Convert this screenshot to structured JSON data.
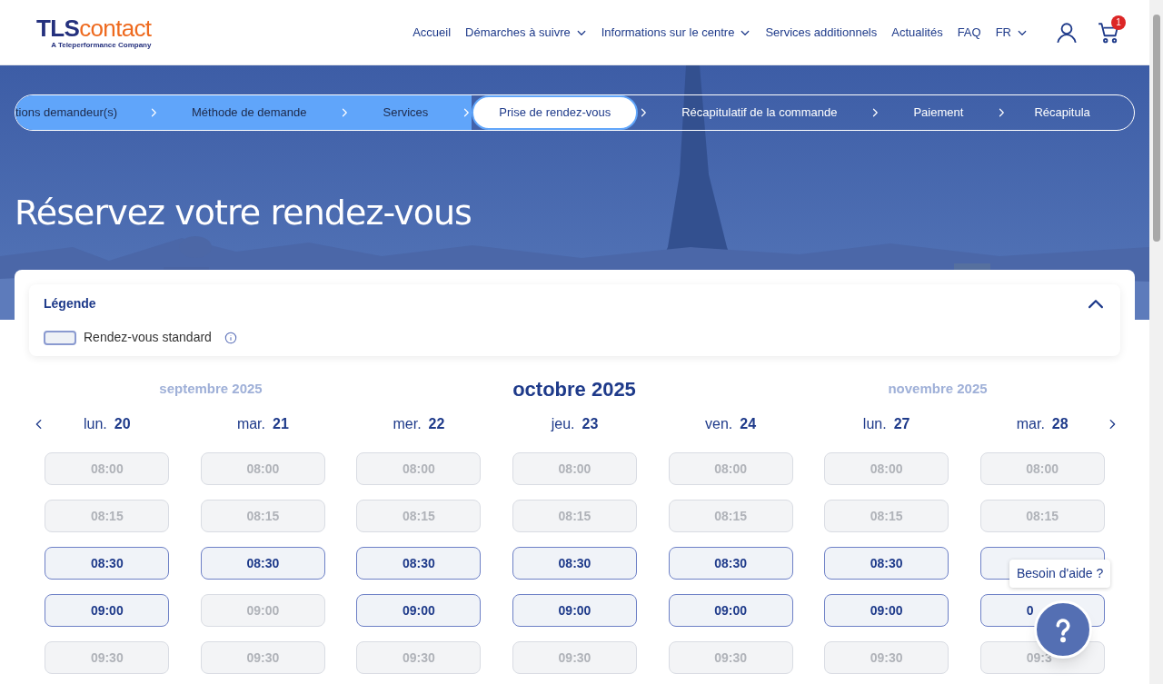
{
  "header": {
    "logo": {
      "primary": "TLS",
      "secondary": "contact",
      "tagline": "A Teleperformance Company"
    },
    "nav": [
      {
        "label": "Accueil",
        "dropdown": false
      },
      {
        "label": "Démarches à suivre",
        "dropdown": true
      },
      {
        "label": "Informations sur le centre",
        "dropdown": true
      },
      {
        "label": "Services additionnels",
        "dropdown": false
      },
      {
        "label": "Actualités",
        "dropdown": false
      },
      {
        "label": "FAQ",
        "dropdown": false
      },
      {
        "label": "FR",
        "dropdown": true
      }
    ],
    "cart_count": "1"
  },
  "steps": [
    {
      "label": "tions demandeur(s)",
      "done": true,
      "selected": false
    },
    {
      "label": "Méthode de demande",
      "done": true,
      "selected": false
    },
    {
      "label": "Services",
      "done": true,
      "selected": false
    },
    {
      "label": "Prise de rendez-vous",
      "done": false,
      "selected": true
    },
    {
      "label": "Récapitulatif de la commande",
      "done": false,
      "selected": false
    },
    {
      "label": "Paiement",
      "done": false,
      "selected": false
    },
    {
      "label": "Récapitula",
      "done": false,
      "selected": false
    }
  ],
  "title": "Réservez votre rendez-vous",
  "legend": {
    "title": "Légende",
    "expanded": true,
    "items": [
      {
        "label": "Rendez-vous standard"
      }
    ]
  },
  "months": [
    {
      "label": "septembre 2025",
      "selected": false
    },
    {
      "label": "octobre 2025",
      "selected": true
    },
    {
      "label": "novembre 2025",
      "selected": false
    }
  ],
  "days": [
    {
      "weekday": "lun.",
      "date": "20",
      "slots": [
        {
          "time": "08:00",
          "available": false
        },
        {
          "time": "08:15",
          "available": false
        },
        {
          "time": "08:30",
          "available": true
        },
        {
          "time": "09:00",
          "available": true
        },
        {
          "time": "09:30",
          "available": false
        }
      ]
    },
    {
      "weekday": "mar.",
      "date": "21",
      "slots": [
        {
          "time": "08:00",
          "available": false
        },
        {
          "time": "08:15",
          "available": false
        },
        {
          "time": "08:30",
          "available": true
        },
        {
          "time": "09:00",
          "available": false
        },
        {
          "time": "09:30",
          "available": false
        }
      ]
    },
    {
      "weekday": "mer.",
      "date": "22",
      "slots": [
        {
          "time": "08:00",
          "available": false
        },
        {
          "time": "08:15",
          "available": false
        },
        {
          "time": "08:30",
          "available": true
        },
        {
          "time": "09:00",
          "available": true
        },
        {
          "time": "09:30",
          "available": false
        }
      ]
    },
    {
      "weekday": "jeu.",
      "date": "23",
      "slots": [
        {
          "time": "08:00",
          "available": false
        },
        {
          "time": "08:15",
          "available": false
        },
        {
          "time": "08:30",
          "available": true
        },
        {
          "time": "09:00",
          "available": true
        },
        {
          "time": "09:30",
          "available": false
        }
      ]
    },
    {
      "weekday": "ven.",
      "date": "24",
      "slots": [
        {
          "time": "08:00",
          "available": false
        },
        {
          "time": "08:15",
          "available": false
        },
        {
          "time": "08:30",
          "available": true
        },
        {
          "time": "09:00",
          "available": true
        },
        {
          "time": "09:30",
          "available": false
        }
      ]
    },
    {
      "weekday": "lun.",
      "date": "27",
      "slots": [
        {
          "time": "08:00",
          "available": false
        },
        {
          "time": "08:15",
          "available": false
        },
        {
          "time": "08:30",
          "available": true
        },
        {
          "time": "09:00",
          "available": true
        },
        {
          "time": "09:30",
          "available": false
        }
      ]
    },
    {
      "weekday": "mar.",
      "date": "28",
      "slots": [
        {
          "time": "08:00",
          "available": false
        },
        {
          "time": "08:15",
          "available": false
        },
        {
          "available": true
        },
        {
          "time": "0",
          "available": true,
          "clipped": true
        },
        {
          "time": "09:3",
          "available": false,
          "clipped": true
        }
      ]
    }
  ],
  "help": {
    "tooltip": "Besoin d'aide ?"
  }
}
